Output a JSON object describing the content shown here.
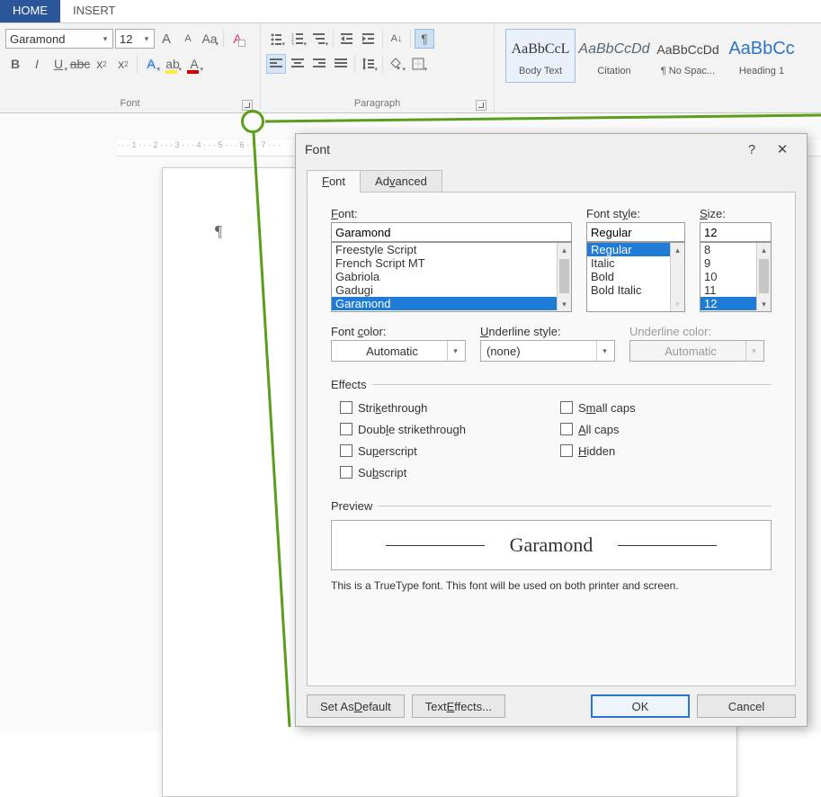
{
  "tabs": {
    "home": "HOME",
    "insert": "INSERT"
  },
  "ribbon": {
    "font": {
      "title": "Font",
      "name_value": "Garamond",
      "size_value": "12",
      "grow": "A",
      "shrink": "A",
      "case": "Aa",
      "clear": "A",
      "bold": "B",
      "italic": "I",
      "underline": "U",
      "dstrike": "abc",
      "sub": "x",
      "sup": "x",
      "texteffects": "A",
      "highlight": "ab",
      "fontcolor": "A"
    },
    "para": {
      "title": "Paragraph",
      "pilcrow": "¶"
    },
    "styles": {
      "sample": "AaBbCcL",
      "body": "Body Text",
      "sample2": "AaBbCcDd",
      "citation": "Citation",
      "sample3": "AaBbCcDd",
      "nospace": "¶ No Spac...",
      "sample4": "AaBbCc",
      "heading1": "Heading 1"
    }
  },
  "doc": {
    "pilcrow": "¶"
  },
  "dialog": {
    "title": "Font",
    "help": "?",
    "close": "✕",
    "tab_font": "Font",
    "tab_adv": "Advanced",
    "font_label_pre": "F",
    "font_label_post": "ont:",
    "font_value": "Garamond",
    "font_list": [
      "Freestyle Script",
      "French Script MT",
      "Gabriola",
      "Gadugi",
      "Garamond"
    ],
    "style_label_pre": "Font st",
    "style_label_u": "y",
    "style_label_post": "le:",
    "style_value": "Regular",
    "style_list": [
      "Regular",
      "Italic",
      "Bold",
      "Bold Italic"
    ],
    "size_label_u": "S",
    "size_label_post": "ize:",
    "size_value": "12",
    "size_list": [
      "8",
      "9",
      "10",
      "11",
      "12"
    ],
    "color_label_pre": "Font ",
    "color_label_u": "c",
    "color_label_post": "olor:",
    "color_value": "Automatic",
    "ul_label_u": "U",
    "ul_label_post": "nderline style:",
    "ul_value": "(none)",
    "ulc_label": "Underline color:",
    "ulc_value": "Automatic",
    "effects": "Effects",
    "fx_strike_u": "k",
    "fx_strike_pre": "Stri",
    "fx_strike_post": "ethrough",
    "fx_dstrike_pre": "Doub",
    "fx_dstrike_u": "l",
    "fx_dstrike_post": "e strikethrough",
    "fx_super_pre": "Su",
    "fx_super_u": "p",
    "fx_super_post": "erscript",
    "fx_sub_pre": "Su",
    "fx_sub_u": "b",
    "fx_sub_post": "script",
    "fx_small_pre": "S",
    "fx_small_u": "m",
    "fx_small_post": "all caps",
    "fx_all_u": "A",
    "fx_all_post": "ll caps",
    "fx_hidden_u": "H",
    "fx_hidden_post": "idden",
    "preview_label": "Preview",
    "preview_text": "Garamond",
    "preview_note": "This is a TrueType font. This font will be used on both printer and screen.",
    "btn_default_pre": "Set As ",
    "btn_default_u": "D",
    "btn_default_post": "efault",
    "btn_texteffects_pre": "Text ",
    "btn_texteffects_u": "E",
    "btn_texteffects_post": "ffects...",
    "btn_ok": "OK",
    "btn_cancel": "Cancel"
  }
}
